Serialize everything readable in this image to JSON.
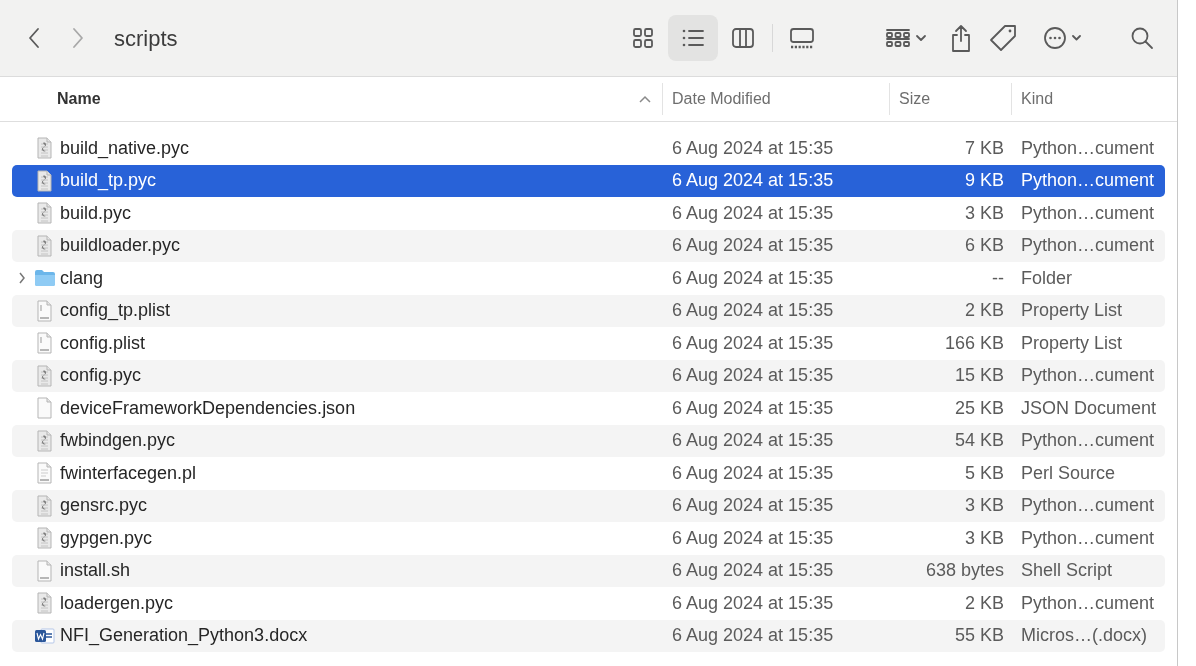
{
  "window": {
    "title": "scripts"
  },
  "toolbar": {
    "views": [
      {
        "selected": false
      },
      {
        "selected": true
      },
      {
        "selected": false
      },
      {
        "selected": false
      }
    ]
  },
  "table": {
    "columns": [
      {
        "label": "Name",
        "sorted": true
      },
      {
        "label": "Date Modified",
        "sorted": false
      },
      {
        "label": "Size",
        "sorted": false
      },
      {
        "label": "Kind",
        "sorted": false
      }
    ],
    "rows": [
      {
        "name": "build_native.pyc",
        "kind": "pyc",
        "date": "6 Aug 2024 at 15:35",
        "size": "7 KB",
        "type": "Python…cument",
        "selected": false
      },
      {
        "name": "build_tp.pyc",
        "kind": "pyc",
        "date": "6 Aug 2024 at 15:35",
        "size": "9 KB",
        "type": "Python…cument",
        "selected": true
      },
      {
        "name": "build.pyc",
        "kind": "pyc",
        "date": "6 Aug 2024 at 15:35",
        "size": "3 KB",
        "type": "Python…cument",
        "selected": false
      },
      {
        "name": "buildloader.pyc",
        "kind": "pyc",
        "date": "6 Aug 2024 at 15:35",
        "size": "6 KB",
        "type": "Python…cument",
        "selected": false
      },
      {
        "name": "clang",
        "kind": "folder",
        "expanded": false,
        "date": "6 Aug 2024 at 15:35",
        "size": "--",
        "type": "Folder",
        "selected": false
      },
      {
        "name": "config_tp.plist",
        "kind": "plist",
        "date": "6 Aug 2024 at 15:35",
        "size": "2 KB",
        "type": "Property List",
        "selected": false
      },
      {
        "name": "config.plist",
        "kind": "plist",
        "date": "6 Aug 2024 at 15:35",
        "size": "166 KB",
        "type": "Property List",
        "selected": false
      },
      {
        "name": "config.pyc",
        "kind": "pyc",
        "date": "6 Aug 2024 at 15:35",
        "size": "15 KB",
        "type": "Python…cument",
        "selected": false
      },
      {
        "name": "deviceFrameworkDependencies.json",
        "kind": "json",
        "date": "6 Aug 2024 at 15:35",
        "size": "25 KB",
        "type": "JSON Document",
        "selected": false
      },
      {
        "name": "fwbindgen.pyc",
        "kind": "pyc",
        "date": "6 Aug 2024 at 15:35",
        "size": "54 KB",
        "type": "Python…cument",
        "selected": false
      },
      {
        "name": "fwinterfacegen.pl",
        "kind": "perl",
        "date": "6 Aug 2024 at 15:35",
        "size": "5 KB",
        "type": "Perl Source",
        "selected": false
      },
      {
        "name": "gensrc.pyc",
        "kind": "pyc",
        "date": "6 Aug 2024 at 15:35",
        "size": "3 KB",
        "type": "Python…cument",
        "selected": false
      },
      {
        "name": "gypgen.pyc",
        "kind": "pyc",
        "date": "6 Aug 2024 at 15:35",
        "size": "3 KB",
        "type": "Python…cument",
        "selected": false
      },
      {
        "name": "install.sh",
        "kind": "shell",
        "date": "6 Aug 2024 at 15:35",
        "size": "638 bytes",
        "type": "Shell Script",
        "selected": false
      },
      {
        "name": "loadergen.pyc",
        "kind": "pyc",
        "date": "6 Aug 2024 at 15:35",
        "size": "2 KB",
        "type": "Python…cument",
        "selected": false
      },
      {
        "name": "NFI_Generation_Python3.docx",
        "kind": "docx",
        "date": "6 Aug 2024 at 15:35",
        "size": "55 KB",
        "type": "Micros…(.docx)",
        "selected": false
      }
    ]
  }
}
